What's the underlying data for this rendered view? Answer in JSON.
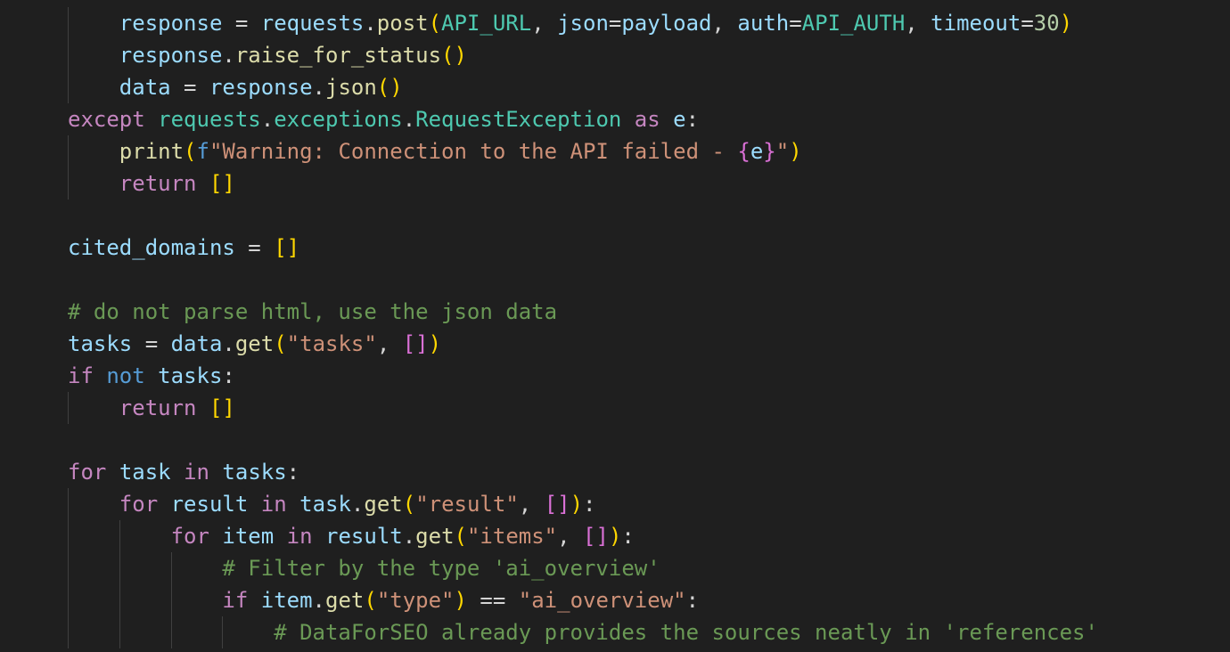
{
  "editor": {
    "language": "python",
    "colors": {
      "background": "#1f1f1f",
      "keyword": "#c586c0",
      "variable": "#9cdcfe",
      "function": "#dcdcaa",
      "class": "#4ec9b0",
      "string": "#ce9178",
      "number": "#b5cea8",
      "comment": "#6a9955"
    },
    "lines": [
      {
        "indent": 1,
        "tokens": [
          {
            "t": "response",
            "c": "var"
          },
          {
            "t": " = ",
            "c": "op"
          },
          {
            "t": "requests",
            "c": "var"
          },
          {
            "t": ".",
            "c": "op"
          },
          {
            "t": "post",
            "c": "fn"
          },
          {
            "t": "(",
            "c": "b1"
          },
          {
            "t": "API_URL",
            "c": "cls"
          },
          {
            "t": ", ",
            "c": "op"
          },
          {
            "t": "json",
            "c": "var"
          },
          {
            "t": "=",
            "c": "op"
          },
          {
            "t": "payload",
            "c": "var"
          },
          {
            "t": ", ",
            "c": "op"
          },
          {
            "t": "auth",
            "c": "var"
          },
          {
            "t": "=",
            "c": "op"
          },
          {
            "t": "API_AUTH",
            "c": "cls"
          },
          {
            "t": ", ",
            "c": "op"
          },
          {
            "t": "timeout",
            "c": "var"
          },
          {
            "t": "=",
            "c": "op"
          },
          {
            "t": "30",
            "c": "num"
          },
          {
            "t": ")",
            "c": "b1"
          }
        ]
      },
      {
        "indent": 1,
        "tokens": [
          {
            "t": "response",
            "c": "var"
          },
          {
            "t": ".",
            "c": "op"
          },
          {
            "t": "raise_for_status",
            "c": "fn"
          },
          {
            "t": "()",
            "c": "b1"
          }
        ]
      },
      {
        "indent": 1,
        "tokens": [
          {
            "t": "data",
            "c": "var"
          },
          {
            "t": " = ",
            "c": "op"
          },
          {
            "t": "response",
            "c": "var"
          },
          {
            "t": ".",
            "c": "op"
          },
          {
            "t": "json",
            "c": "fn"
          },
          {
            "t": "()",
            "c": "b1"
          }
        ]
      },
      {
        "indent": 0,
        "tokens": [
          {
            "t": "except",
            "c": "kw"
          },
          {
            "t": " ",
            "c": "op"
          },
          {
            "t": "requests",
            "c": "cls"
          },
          {
            "t": ".",
            "c": "op"
          },
          {
            "t": "exceptions",
            "c": "cls"
          },
          {
            "t": ".",
            "c": "op"
          },
          {
            "t": "RequestException",
            "c": "cls"
          },
          {
            "t": " ",
            "c": "op"
          },
          {
            "t": "as",
            "c": "kw"
          },
          {
            "t": " ",
            "c": "op"
          },
          {
            "t": "e",
            "c": "var"
          },
          {
            "t": ":",
            "c": "op"
          }
        ]
      },
      {
        "indent": 1,
        "tokens": [
          {
            "t": "print",
            "c": "fn"
          },
          {
            "t": "(",
            "c": "b1"
          },
          {
            "t": "f",
            "c": "kw2"
          },
          {
            "t": "\"Warning: Connection to the API failed - ",
            "c": "str"
          },
          {
            "t": "{",
            "c": "b2"
          },
          {
            "t": "e",
            "c": "var"
          },
          {
            "t": "}",
            "c": "b2"
          },
          {
            "t": "\"",
            "c": "str"
          },
          {
            "t": ")",
            "c": "b1"
          }
        ]
      },
      {
        "indent": 1,
        "tokens": [
          {
            "t": "return",
            "c": "kw"
          },
          {
            "t": " ",
            "c": "op"
          },
          {
            "t": "[]",
            "c": "b1"
          }
        ]
      },
      {
        "indent": 0,
        "tokens": []
      },
      {
        "indent": 0,
        "tokens": [
          {
            "t": "cited_domains",
            "c": "var"
          },
          {
            "t": " = ",
            "c": "op"
          },
          {
            "t": "[]",
            "c": "b1"
          }
        ]
      },
      {
        "indent": 0,
        "tokens": []
      },
      {
        "indent": 0,
        "tokens": [
          {
            "t": "# do not parse html, use the json data",
            "c": "cmt"
          }
        ]
      },
      {
        "indent": 0,
        "tokens": [
          {
            "t": "tasks",
            "c": "var"
          },
          {
            "t": " = ",
            "c": "op"
          },
          {
            "t": "data",
            "c": "var"
          },
          {
            "t": ".",
            "c": "op"
          },
          {
            "t": "get",
            "c": "fn"
          },
          {
            "t": "(",
            "c": "b1"
          },
          {
            "t": "\"tasks\"",
            "c": "str"
          },
          {
            "t": ", ",
            "c": "op"
          },
          {
            "t": "[]",
            "c": "b2"
          },
          {
            "t": ")",
            "c": "b1"
          }
        ]
      },
      {
        "indent": 0,
        "tokens": [
          {
            "t": "if",
            "c": "kw"
          },
          {
            "t": " ",
            "c": "op"
          },
          {
            "t": "not",
            "c": "kw2"
          },
          {
            "t": " ",
            "c": "op"
          },
          {
            "t": "tasks",
            "c": "var"
          },
          {
            "t": ":",
            "c": "op"
          }
        ]
      },
      {
        "indent": 1,
        "tokens": [
          {
            "t": "return",
            "c": "kw"
          },
          {
            "t": " ",
            "c": "op"
          },
          {
            "t": "[]",
            "c": "b1"
          }
        ]
      },
      {
        "indent": 0,
        "tokens": []
      },
      {
        "indent": 0,
        "tokens": [
          {
            "t": "for",
            "c": "kw"
          },
          {
            "t": " ",
            "c": "op"
          },
          {
            "t": "task",
            "c": "var"
          },
          {
            "t": " ",
            "c": "op"
          },
          {
            "t": "in",
            "c": "kw"
          },
          {
            "t": " ",
            "c": "op"
          },
          {
            "t": "tasks",
            "c": "var"
          },
          {
            "t": ":",
            "c": "op"
          }
        ]
      },
      {
        "indent": 1,
        "tokens": [
          {
            "t": "for",
            "c": "kw"
          },
          {
            "t": " ",
            "c": "op"
          },
          {
            "t": "result",
            "c": "var"
          },
          {
            "t": " ",
            "c": "op"
          },
          {
            "t": "in",
            "c": "kw"
          },
          {
            "t": " ",
            "c": "op"
          },
          {
            "t": "task",
            "c": "var"
          },
          {
            "t": ".",
            "c": "op"
          },
          {
            "t": "get",
            "c": "fn"
          },
          {
            "t": "(",
            "c": "b1"
          },
          {
            "t": "\"result\"",
            "c": "str"
          },
          {
            "t": ", ",
            "c": "op"
          },
          {
            "t": "[]",
            "c": "b2"
          },
          {
            "t": ")",
            "c": "b1"
          },
          {
            "t": ":",
            "c": "op"
          }
        ]
      },
      {
        "indent": 2,
        "tokens": [
          {
            "t": "for",
            "c": "kw"
          },
          {
            "t": " ",
            "c": "op"
          },
          {
            "t": "item",
            "c": "var"
          },
          {
            "t": " ",
            "c": "op"
          },
          {
            "t": "in",
            "c": "kw"
          },
          {
            "t": " ",
            "c": "op"
          },
          {
            "t": "result",
            "c": "var"
          },
          {
            "t": ".",
            "c": "op"
          },
          {
            "t": "get",
            "c": "fn"
          },
          {
            "t": "(",
            "c": "b1"
          },
          {
            "t": "\"items\"",
            "c": "str"
          },
          {
            "t": ", ",
            "c": "op"
          },
          {
            "t": "[]",
            "c": "b2"
          },
          {
            "t": ")",
            "c": "b1"
          },
          {
            "t": ":",
            "c": "op"
          }
        ]
      },
      {
        "indent": 3,
        "tokens": [
          {
            "t": "# Filter by the type 'ai_overview'",
            "c": "cmt"
          }
        ]
      },
      {
        "indent": 3,
        "tokens": [
          {
            "t": "if",
            "c": "kw"
          },
          {
            "t": " ",
            "c": "op"
          },
          {
            "t": "item",
            "c": "var"
          },
          {
            "t": ".",
            "c": "op"
          },
          {
            "t": "get",
            "c": "fn"
          },
          {
            "t": "(",
            "c": "b1"
          },
          {
            "t": "\"type\"",
            "c": "str"
          },
          {
            "t": ")",
            "c": "b1"
          },
          {
            "t": " == ",
            "c": "op"
          },
          {
            "t": "\"ai_overview\"",
            "c": "str"
          },
          {
            "t": ":",
            "c": "op"
          }
        ]
      },
      {
        "indent": 4,
        "tokens": [
          {
            "t": "# DataForSEO already provides the sources neatly in 'references'",
            "c": "cmt"
          }
        ]
      }
    ]
  }
}
